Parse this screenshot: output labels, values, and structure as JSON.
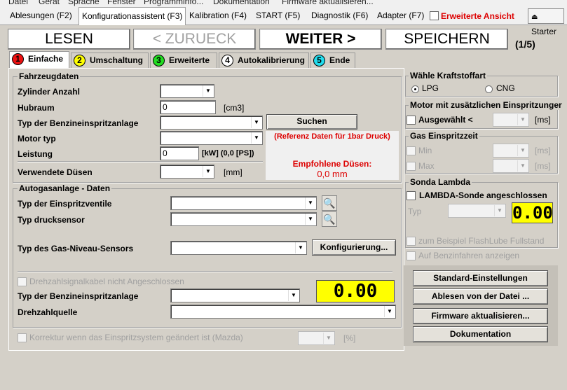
{
  "menubar": [
    "Datei",
    "Gerät",
    "Sprache",
    "Fenster",
    "Programminfo...",
    "Dokumentation",
    "Firmware aktualisieren..."
  ],
  "top_tabs": [
    "Ablesungen (F2)",
    "Konfigurationassistent (F3)",
    "Kalibration (F4)",
    "START (F5)",
    "Diagnostik (F6)",
    "Adapter (F7)"
  ],
  "erweiterte_ansicht": "Erweiterte Ansicht",
  "starter": "Starter",
  "nav": {
    "lesen": "LESEN",
    "zurueck": "< ZURUECK",
    "weiter": "WEITER >",
    "speichern": "SPEICHERN",
    "step": "(1/5)"
  },
  "wizard_tabs": [
    {
      "num": "1",
      "label": "Einfache",
      "color": "#ee1111"
    },
    {
      "num": "2",
      "label": "Umschaltung",
      "color": "#ffff00"
    },
    {
      "num": "3",
      "label": "Erweiterte",
      "color": "#22dd22"
    },
    {
      "num": "4",
      "label": "Autokalibrierung",
      "color": "#ffffff"
    },
    {
      "num": "5",
      "label": "Ende",
      "color": "#22ddee"
    }
  ],
  "fahrzeug": {
    "title": "Fahrzeugdaten",
    "zylinder": "Zylinder Anzahl",
    "hubraum": "Hubraum",
    "hubraum_val": "0",
    "hubraum_unit": "[cm3]",
    "benzin": "Typ der Benzineinspritzanlage",
    "motor": "Motor typ",
    "leistung": "Leistung",
    "leistung_val": "0",
    "leistung_unit": "[kW] (0,0 [PS])",
    "duesen": "Verwendete Düsen",
    "duesen_unit": "[mm]",
    "suchen": "Suchen",
    "referenz": "(Referenz Daten für 1bar Druck)",
    "empfohlene": "Empfohlene Düsen:",
    "empfohlene_val": "0,0 mm"
  },
  "autogas": {
    "title": "Autogasanlage - Daten",
    "ventile": "Typ der Einspritzventile",
    "sensor": "Typ drucksensor",
    "niveau": "Typ des Gas-Niveau-Sensors",
    "konfig": "Konfigurierung...",
    "drehkabel": "Drehzahlsignalkabel nicht Angeschlossen",
    "benzin": "Typ der Benzineinspritzanlage",
    "drehquelle": "Drehzahlquelle",
    "lcd": "0.00"
  },
  "korrektur": {
    "label": "Korrektur wenn das Einspritzsystem geändert ist (Mazda)",
    "unit": "[%]"
  },
  "kraftstoff": {
    "title": "Wähle Kraftstoffart",
    "lpg": "LPG",
    "cng": "CNG"
  },
  "motor": {
    "title": "Motor mit zusätzlichen Einspritzunger",
    "ausgewaehlt": "Ausgewählt <",
    "unit": "[ms]"
  },
  "gaszeit": {
    "title": "Gas Einspritzzeit",
    "min": "Min",
    "max": "Max",
    "unit": "[ms]"
  },
  "lambda": {
    "title": "Sonda Lambda",
    "angeschlossen": "LAMBDA-Sonde angeschlossen",
    "typ": "Typ",
    "lcd": "0.00",
    "flash": "zum Beispiel FlashLube Fullstand",
    "benzin": "Auf Benzinfahren anzeigen"
  },
  "buttons": {
    "standard": "Standard-Einstellungen",
    "ablesen": "Ablesen von der Datei ...",
    "firmware": "Firmware aktualisieren...",
    "doku": "Dokumentation"
  }
}
